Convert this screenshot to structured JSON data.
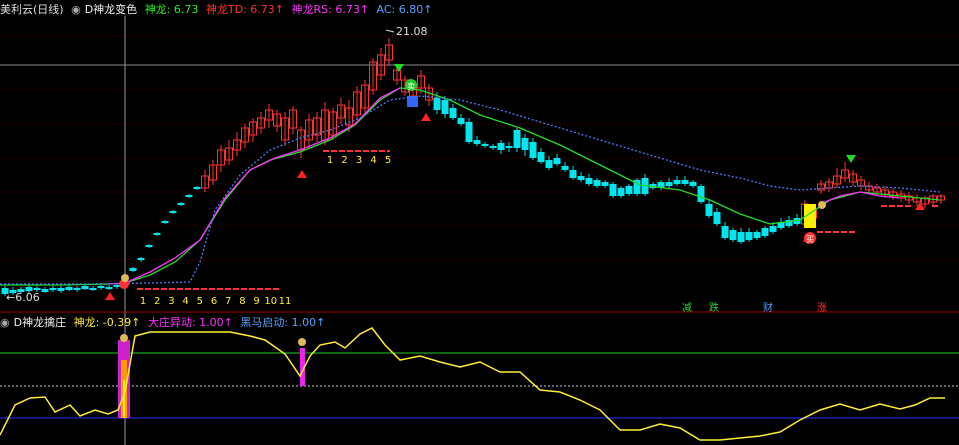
{
  "main_header": {
    "stock": "美利云(日线)",
    "indicator": "D神龙变色",
    "items": [
      {
        "label": "神龙: 6.73",
        "color": "#22ee22"
      },
      {
        "label": "神龙TD: 6.73↑",
        "color": "#ff3333"
      },
      {
        "label": "神龙RS: 6.73↑",
        "color": "#ff33ff"
      },
      {
        "label": "AC: 6.80↑",
        "color": "#5aa0ff"
      }
    ]
  },
  "sub_header": {
    "indicator": "D神龙擒庄",
    "items": [
      {
        "label": "神龙: -0.39↑",
        "color": "#ffee33"
      },
      {
        "label": "大庄异动: 1.00↑",
        "color": "#ff33ff"
      },
      {
        "label": "黑马启动: 1.00↑",
        "color": "#5aa0ff"
      }
    ]
  },
  "price_labels": {
    "high": "21.08",
    "low": "6.06"
  },
  "count_seq_1": [
    "1",
    "2",
    "3",
    "4",
    "5",
    "6",
    "7",
    "8",
    "9",
    "10",
    "11"
  ],
  "count_seq_2": [
    "1",
    "2",
    "3",
    "4",
    "5"
  ],
  "signal_tags": [
    {
      "text": "减",
      "color": "#33cc33"
    },
    {
      "text": "跌",
      "color": "#33cc33"
    },
    {
      "text": "财",
      "color": "#5599ff"
    },
    {
      "text": "涨",
      "color": "#ff3333"
    }
  ],
  "marker_glyphs": {
    "buy": "买",
    "sell": "卖"
  },
  "colors": {
    "up": "#ff3333",
    "down": "#00e5ee",
    "ma_green": "#22dd22",
    "ma_magenta": "#ff33ff",
    "ma_blue": "#4a7aff",
    "osc": "#ffee33"
  }
}
